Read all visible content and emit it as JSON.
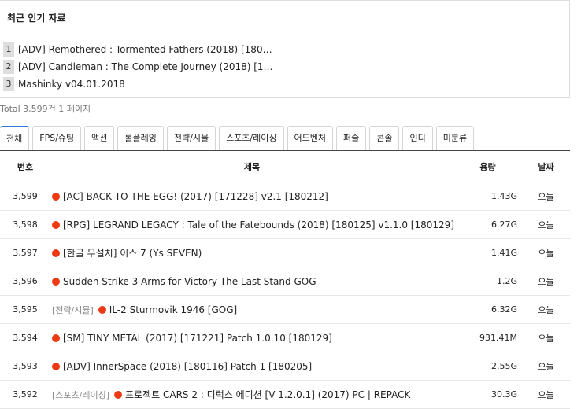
{
  "popular": {
    "heading": "최근 인기 자료",
    "items": [
      {
        "rank": "1",
        "text": "[ADV] Remothered : Tormented Fathers (2018) [180…"
      },
      {
        "rank": "2",
        "text": "[ADV] Candleman : The Complete Journey (2018) [1…"
      },
      {
        "rank": "3",
        "text": "Mashinky v04.01.2018"
      }
    ]
  },
  "total": "Total 3,599건 1 페이지",
  "tabs": [
    "전체",
    "FPS/슈팅",
    "액션",
    "롤플레잉",
    "전략/시뮬",
    "스포츠/레이싱",
    "어드벤처",
    "퍼즐",
    "콘솔",
    "인디",
    "미분류"
  ],
  "active_tab": "전체",
  "table": {
    "headers": {
      "num": "번호",
      "title": "제목",
      "size": "용량",
      "date": "날짜"
    },
    "rows": [
      {
        "num": "3,599",
        "category": "",
        "title": "[AC] BACK TO THE EGG! (2017) [171228] v2.1 [180212]",
        "size": "1.43G",
        "date": "오늘"
      },
      {
        "num": "3,598",
        "category": "",
        "title": "[RPG] LEGRAND LEGACY : Tale of the Fatebounds (2018) [180125] v1.1.0 [180129]",
        "size": "6.27G",
        "date": "오늘"
      },
      {
        "num": "3,597",
        "category": "",
        "title": "[한글 무설치] 이스 7 (Ys SEVEN)",
        "size": "1.41G",
        "date": "오늘"
      },
      {
        "num": "3,596",
        "category": "",
        "title": "Sudden Strike 3 Arms for Victory The Last Stand GOG",
        "size": "1.2G",
        "date": "오늘"
      },
      {
        "num": "3,595",
        "category": "[전략/시뮬]",
        "title": "IL-2 Sturmovik 1946 [GOG]",
        "size": "6.32G",
        "date": "오늘"
      },
      {
        "num": "3,594",
        "category": "",
        "title": "[SM] TINY METAL (2017) [171221] Patch 1.0.10 [180129]",
        "size": "931.41M",
        "date": "오늘"
      },
      {
        "num": "3,593",
        "category": "",
        "title": "[ADV] InnerSpace (2018) [180116] Patch 1 [180205]",
        "size": "2.55G",
        "date": "오늘"
      },
      {
        "num": "3,592",
        "category": "[스포츠/레이싱]",
        "title": "프로젝트 CARS 2 : 디럭스 에디션 [V 1.2.0.1] (2017) PC | REPACK",
        "size": "30.3G",
        "date": "오늘"
      }
    ]
  },
  "colors": {
    "accent": "#2e7bd6",
    "new_dot": "#ee3a14"
  }
}
